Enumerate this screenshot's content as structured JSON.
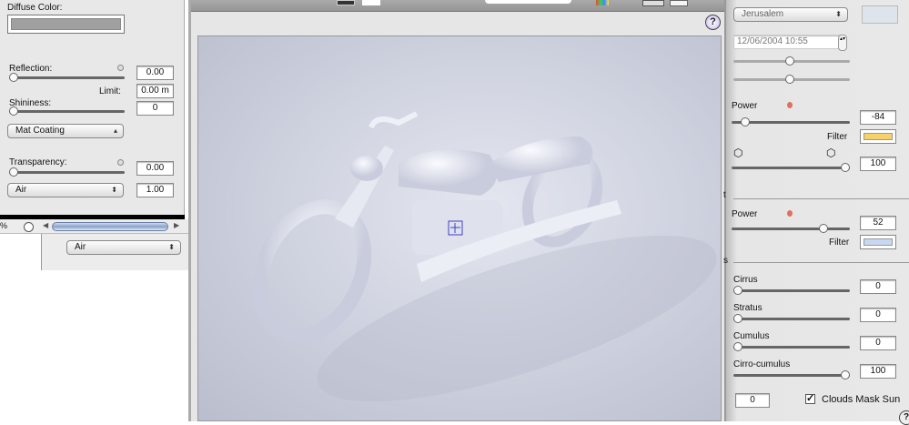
{
  "material_panel": {
    "diffuse_color_label": "Diffuse Color:",
    "diffuse_color": "#a0a0a0",
    "reflection_label": "Reflection:",
    "reflection_value": "0.00",
    "reflection_slider": 0,
    "limit_label": "Limit:",
    "limit_value": "0.00 m",
    "shininess_label": "Shininess:",
    "shininess_value": "0",
    "shininess_slider": 0,
    "coating_select": "Mat Coating",
    "transparency_label": "Transparency:",
    "transparency_value": "0.00",
    "transparency_slider": 0,
    "medium_select": "Air",
    "ior_value": "1.00"
  },
  "bottom_left": {
    "zoom_suffix": "%",
    "medium_select": "Air"
  },
  "viewport": {
    "help_label": "?",
    "background": "#c9cdda"
  },
  "environment_panel": {
    "location_select": "Jerusalem",
    "datetime_value": "12/06/2004 10:55",
    "sun": {
      "power_label": "Power",
      "power_value": "-84",
      "filter_label": "Filter",
      "filter_color": "#f5d36a",
      "shadow_value": "100"
    },
    "sky": {
      "section_letter": "t",
      "power_label": "Power",
      "power_value": "52",
      "filter_label": "Filter",
      "filter_color": "#c9d8f2"
    },
    "clouds": {
      "section_letter": "s",
      "items": [
        {
          "label": "Cirrus",
          "value": "0",
          "fraction": 0
        },
        {
          "label": "Stratus",
          "value": "0",
          "fraction": 0
        },
        {
          "label": "Cumulus",
          "value": "0",
          "fraction": 0
        },
        {
          "label": "Cirro-cumulus",
          "value": "100",
          "fraction": 1
        }
      ],
      "extra_value": "0",
      "mask_sun_label": "Clouds Mask Sun",
      "mask_sun_checked": true,
      "help_label": "?"
    }
  }
}
